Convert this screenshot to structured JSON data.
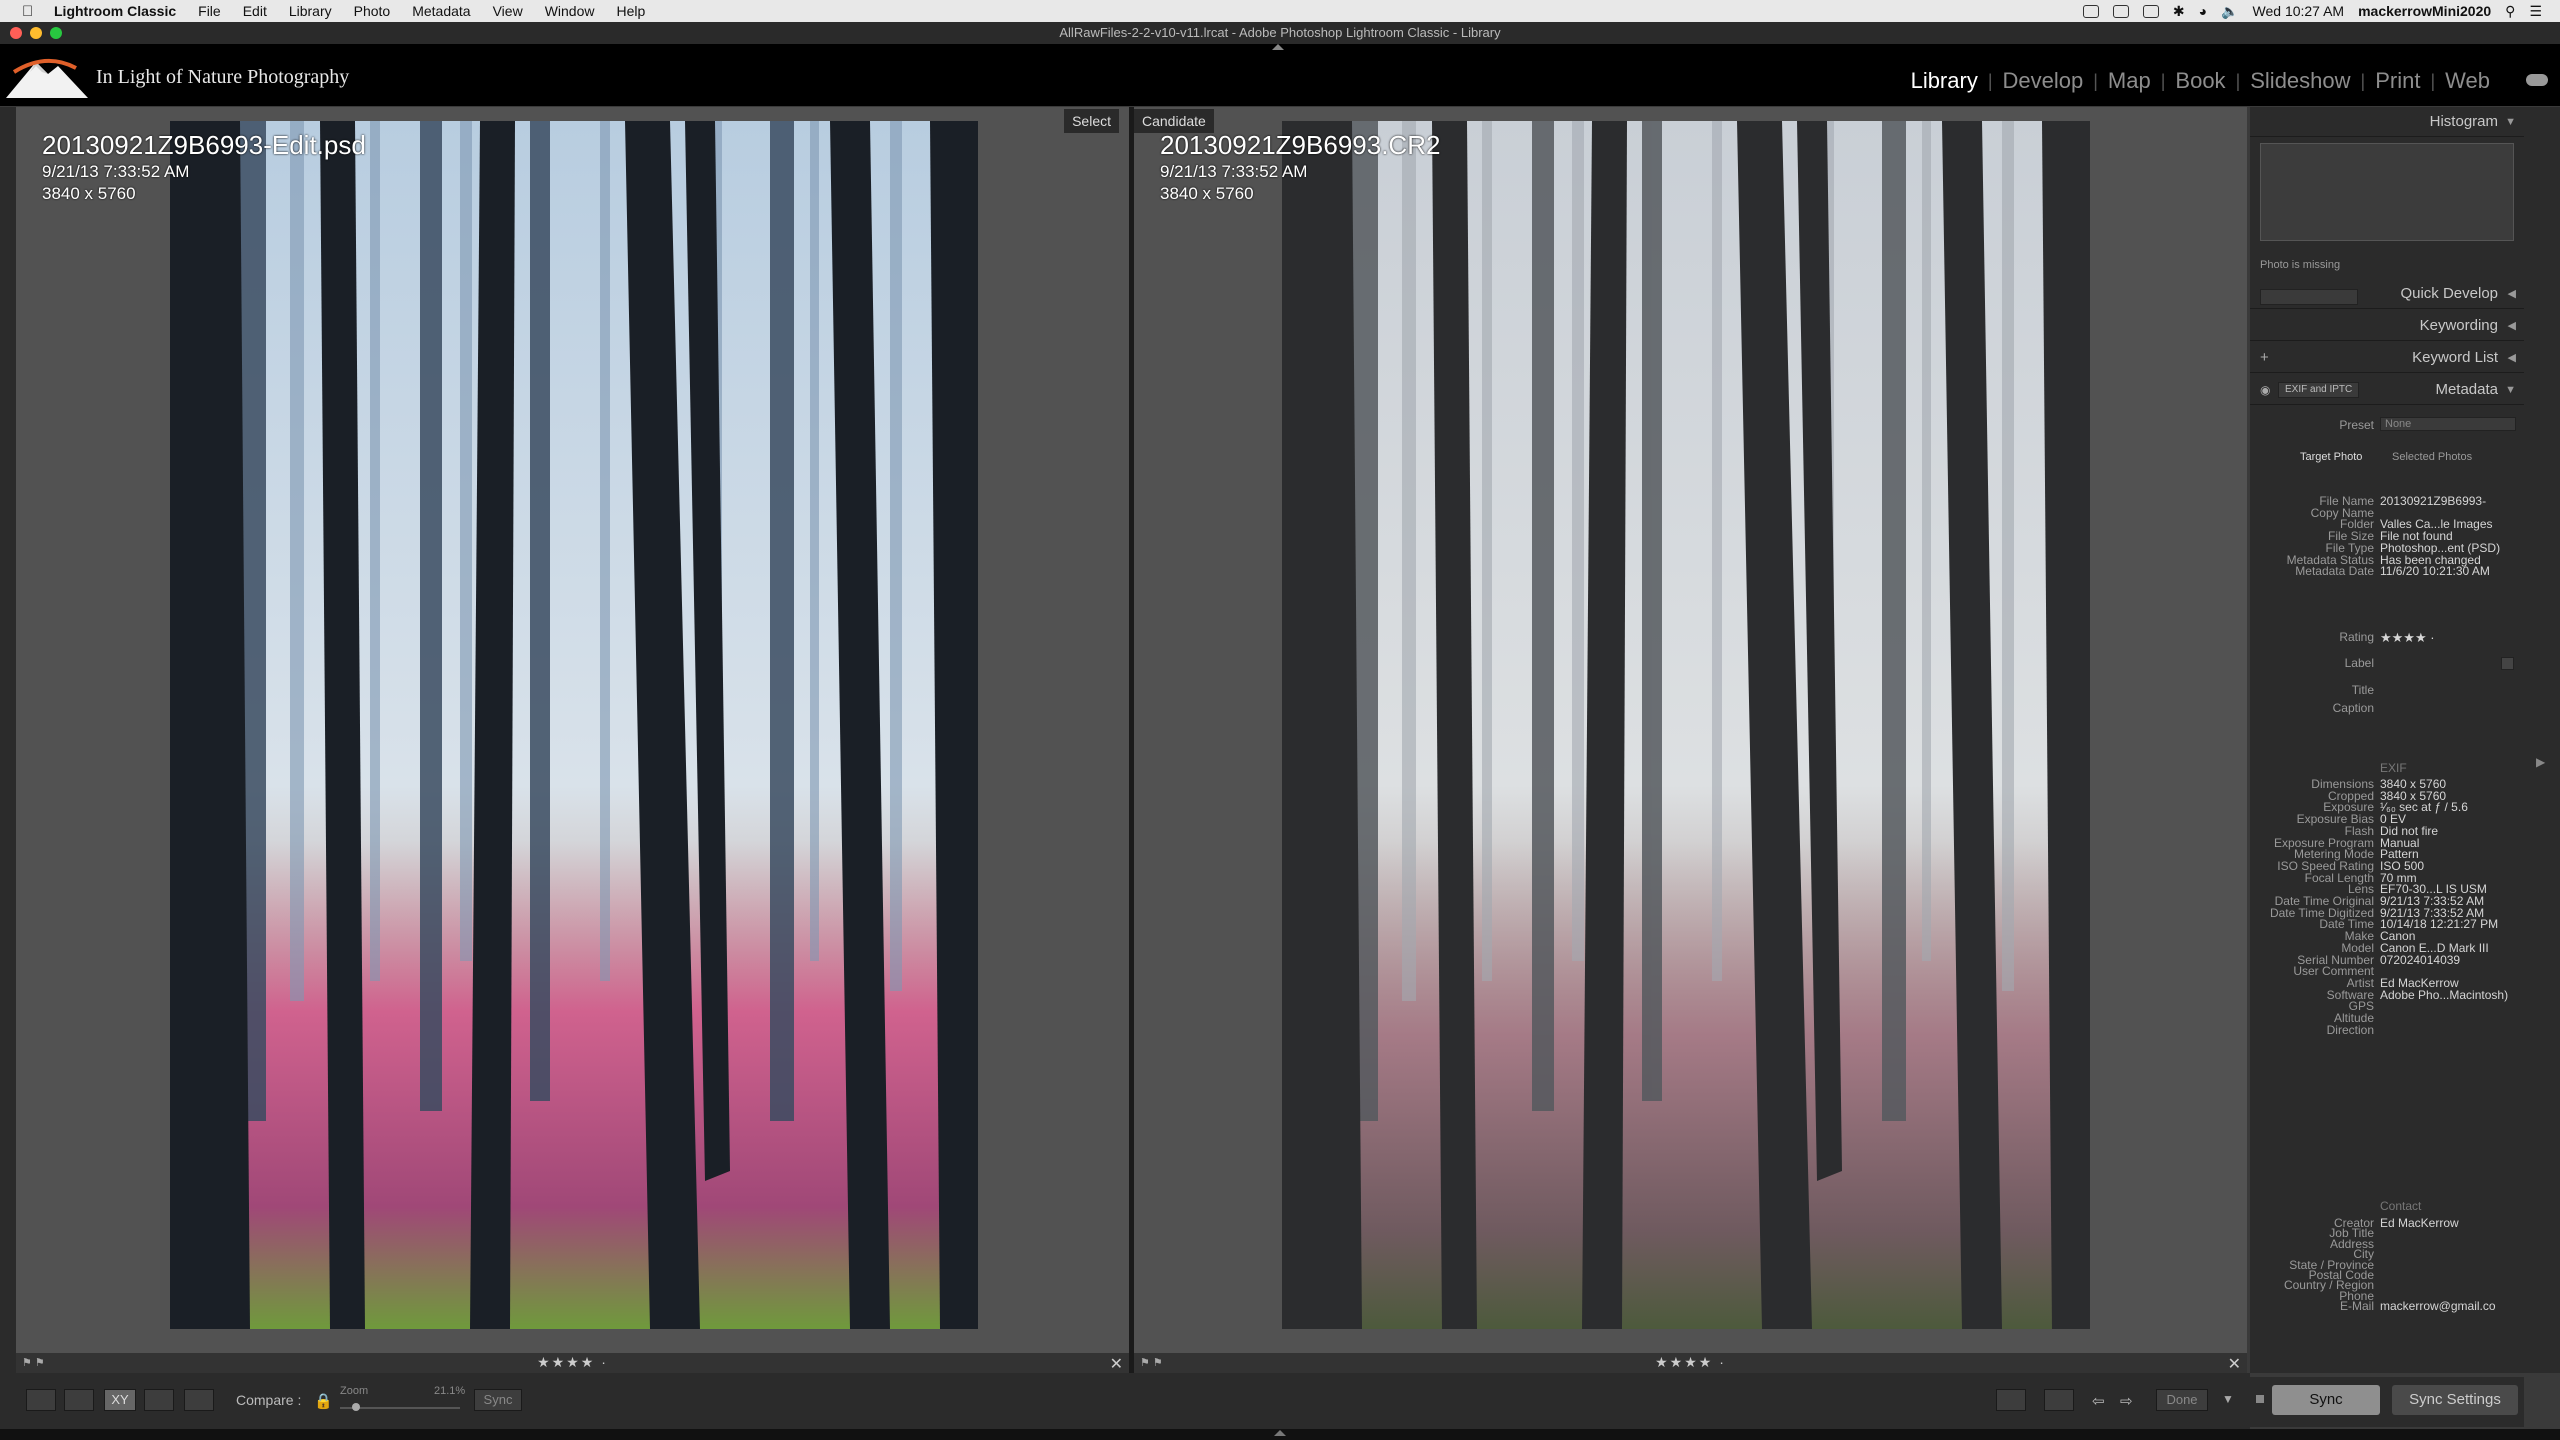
{
  "menubar": {
    "items": [
      "Lightroom Classic",
      "File",
      "Edit",
      "Library",
      "Photo",
      "Metadata",
      "View",
      "Window",
      "Help"
    ],
    "clock": "Wed 10:27 AM",
    "user": "mackerrowMini2020"
  },
  "window": {
    "title": "AllRawFiles-2-2-v10-v11.lrcat - Adobe Photoshop Lightroom Classic - Library"
  },
  "identity_plate": "In Light of Nature Photography",
  "modules": [
    "Library",
    "Develop",
    "Map",
    "Book",
    "Slideshow",
    "Print",
    "Web"
  ],
  "select": {
    "tag": "Select",
    "filename": "20130921Z9B6993-Edit.psd",
    "datetime": "9/21/13 7:33:52 AM",
    "dimensions": "3840 x 5760",
    "stars": "★★★★ ·"
  },
  "candidate": {
    "tag": "Candidate",
    "filename": "20130921Z9B6993.CR2",
    "datetime": "9/21/13 7:33:52 AM",
    "dimensions": "3840 x 5760",
    "stars": "★★★★ ·"
  },
  "panel": {
    "histogram": "Histogram",
    "photo_missing": "Photo is missing",
    "quick_develop": "Quick Develop",
    "keywording": "Keywording",
    "keyword_list": "Keyword List",
    "metadata": "Metadata",
    "metadata_preset_menu": "EXIF and IPTC",
    "preset_label": "Preset",
    "preset_value": "None",
    "target_photo": "Target Photo",
    "selected_photos": "Selected Photos",
    "basic_rows": [
      {
        "k": "File Name",
        "v": "20130921Z9B6993-"
      },
      {
        "k": "Copy Name",
        "v": ""
      },
      {
        "k": "Folder",
        "v": "Valles Ca...le Images"
      },
      {
        "k": "File Size",
        "v": "File not found"
      },
      {
        "k": "File Type",
        "v": "Photoshop...ent (PSD)"
      },
      {
        "k": "Metadata Status",
        "v": "Has been changed"
      },
      {
        "k": "Metadata Date",
        "v": "11/6/20 10:21:30 AM"
      }
    ],
    "rating_label": "Rating",
    "rating_value": "★★★★ ·",
    "label_label": "Label",
    "title_label": "Title",
    "caption_label": "Caption",
    "exif_head": "EXIF",
    "exif_rows": [
      {
        "k": "Dimensions",
        "v": "3840 x 5760"
      },
      {
        "k": "Cropped",
        "v": "3840 x 5760"
      },
      {
        "k": "Exposure",
        "v": "¹⁄₆₀ sec at ƒ / 5.6"
      },
      {
        "k": "Exposure Bias",
        "v": "0 EV"
      },
      {
        "k": "Flash",
        "v": "Did not fire"
      },
      {
        "k": "Exposure Program",
        "v": "Manual"
      },
      {
        "k": "Metering Mode",
        "v": "Pattern"
      },
      {
        "k": "ISO Speed Rating",
        "v": "ISO 500"
      },
      {
        "k": "Focal Length",
        "v": "70 mm"
      },
      {
        "k": "Lens",
        "v": "EF70-30...L IS USM"
      },
      {
        "k": "Date Time Original",
        "v": "9/21/13 7:33:52 AM"
      },
      {
        "k": "Date Time Digitized",
        "v": "9/21/13 7:33:52 AM"
      },
      {
        "k": "Date Time",
        "v": "10/14/18 12:21:27 PM"
      },
      {
        "k": "Make",
        "v": "Canon"
      },
      {
        "k": "Model",
        "v": "Canon E...D Mark III"
      },
      {
        "k": "Serial Number",
        "v": "072024014039"
      },
      {
        "k": "User Comment",
        "v": ""
      },
      {
        "k": "Artist",
        "v": "Ed MacKerrow"
      },
      {
        "k": "Software",
        "v": "Adobe Pho...Macintosh)"
      },
      {
        "k": "GPS",
        "v": ""
      },
      {
        "k": "Altitude",
        "v": ""
      },
      {
        "k": "Direction",
        "v": ""
      }
    ],
    "contact_head": "Contact",
    "contact_rows": [
      {
        "k": "Creator",
        "v": "Ed MacKerrow"
      },
      {
        "k": "Job Title",
        "v": ""
      },
      {
        "k": "Address",
        "v": ""
      },
      {
        "k": "City",
        "v": ""
      },
      {
        "k": "State / Province",
        "v": ""
      },
      {
        "k": "Postal Code",
        "v": ""
      },
      {
        "k": "Country / Region",
        "v": ""
      },
      {
        "k": "Phone",
        "v": ""
      },
      {
        "k": "E-Mail",
        "v": "mackerrow@gmail.co"
      }
    ],
    "sync": "Sync",
    "sync_settings": "Sync Settings"
  },
  "toolbar": {
    "compare_label": "Compare :",
    "zoom_label": "Zoom",
    "zoom_value": "21.1%",
    "sync": "Sync",
    "done": "Done"
  }
}
